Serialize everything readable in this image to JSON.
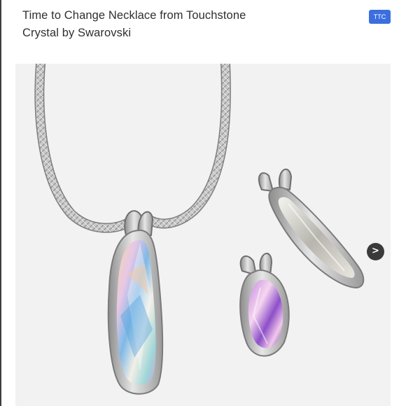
{
  "listing": {
    "title": "Time to Change Necklace from Touchstone Crystal by Swarovski",
    "tag_label": "TTC"
  },
  "gallery": {
    "next_icon": "chevron-right-icon",
    "next_glyph": ">"
  }
}
